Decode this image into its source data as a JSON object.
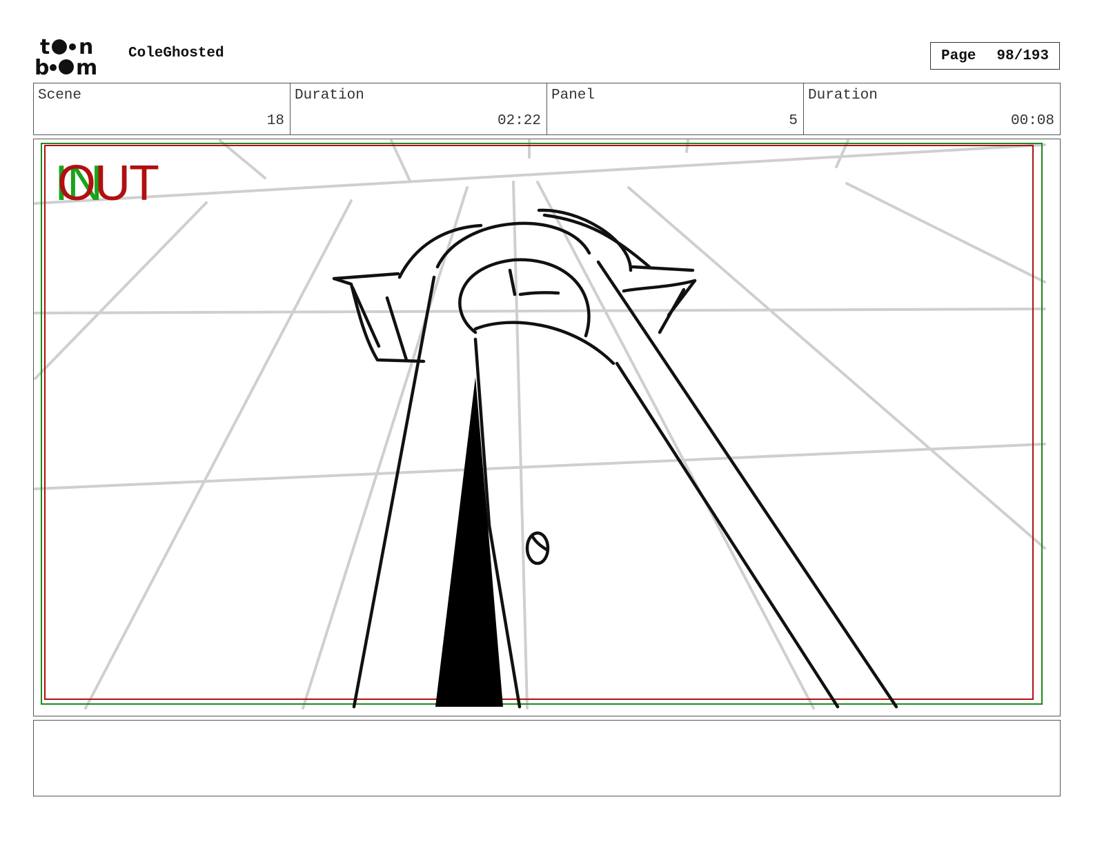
{
  "project": {
    "title": "ColeGhosted"
  },
  "logo": {
    "alt": "toon boom",
    "line1": "toon",
    "line2": "boom"
  },
  "page": {
    "label": "Page",
    "value": "98/193"
  },
  "info": {
    "scene_label": "Scene",
    "scene_value": "18",
    "scene_duration_label": "Duration",
    "scene_duration_value": "02:22",
    "panel_label": "Panel",
    "panel_value": "5",
    "panel_duration_label": "Duration",
    "panel_duration_value": "00:08"
  },
  "panel": {
    "marker_in": "IN",
    "marker_out": "OUT"
  },
  "notes": {
    "text": ""
  },
  "colors": {
    "safe_frame_red": "#b01010",
    "safe_frame_green": "#1a8a1a",
    "guides": "#cfcfcf",
    "ink": "#111111"
  }
}
